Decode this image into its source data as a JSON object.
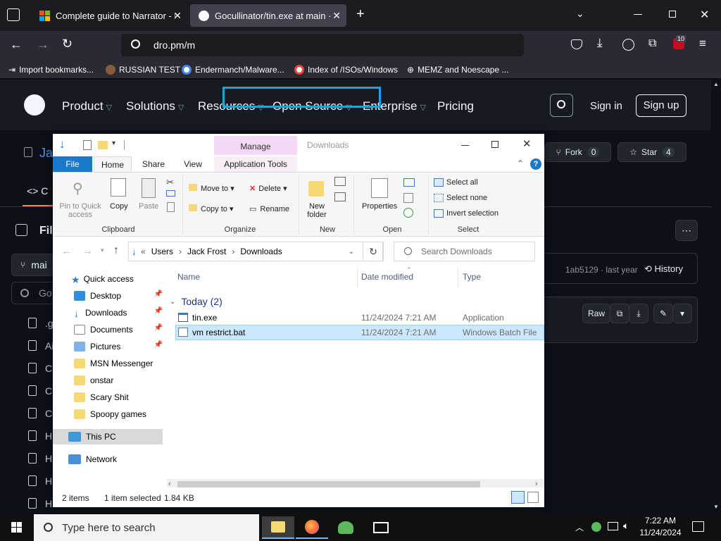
{
  "browser": {
    "tabs": [
      {
        "title": "Complete guide to Narrator - M",
        "active": false
      },
      {
        "title": "Gocullinator/tin.exe at main · Ja",
        "active": true
      }
    ],
    "url": "dro.pm/m",
    "extension_badge": "10",
    "bookmarks": [
      "Import bookmarks...",
      "RUSSIAN TEST",
      "Endermanch/Malware...",
      "Index of /ISOs/Windows",
      "MEMZ and Noescape ..."
    ]
  },
  "github": {
    "nav": [
      "Product",
      "Solutions",
      "Resources",
      "Open Source",
      "Enterprise",
      "Pricing"
    ],
    "sign_in": "Sign in",
    "sign_up": "Sign up",
    "repo_partial": "Ja",
    "fork_label": "Fork",
    "fork_count": "0",
    "star_label": "Star",
    "star_count": "4",
    "code_tab_partial": "C",
    "file_title_partial": "File",
    "branch_partial": "mai",
    "goto_partial": "Go",
    "commit": "1ab5129 · last year",
    "history": "History",
    "raw": "Raw",
    "tree_items": [
      ".g",
      "Ai",
      "Cl",
      "Cl",
      "Co",
      "H",
      "H",
      "H",
      "H"
    ]
  },
  "explorer": {
    "title": "Downloads",
    "manage": "Manage",
    "ribbon_tabs": [
      "File",
      "Home",
      "Share",
      "View",
      "Application Tools"
    ],
    "clipboard": {
      "pin": "Pin to Quick",
      "pin2": "access",
      "copy": "Copy",
      "paste": "Paste",
      "group": "Clipboard"
    },
    "organize": {
      "move_to": "Move to",
      "copy_to": "Copy to",
      "delete": "Delete",
      "rename": "Rename",
      "group": "Organize"
    },
    "new": {
      "new_folder": "New",
      "new_folder2": "folder",
      "group": "New"
    },
    "open": {
      "properties": "Properties",
      "group": "Open"
    },
    "select": {
      "select_all": "Select all",
      "select_none": "Select none",
      "invert": "Invert selection",
      "group": "Select"
    },
    "breadcrumb": [
      "Users",
      "Jack Frost",
      "Downloads"
    ],
    "search_placeholder": "Search Downloads",
    "nav": {
      "quick_access": "Quick access",
      "items": [
        "Desktop",
        "Downloads",
        "Documents",
        "Pictures",
        "MSN Messenger",
        "onstar",
        "Scary Shit",
        "Spoopy games"
      ],
      "this_pc": "This PC",
      "network": "Network"
    },
    "columns": [
      "Name",
      "Date modified",
      "Type"
    ],
    "group_header": "Today (2)",
    "files": [
      {
        "name": "tin.exe",
        "date": "11/24/2024 7:21 AM",
        "type": "Application"
      },
      {
        "name": "vm restrict.bat",
        "date": "11/24/2024 7:21 AM",
        "type": "Windows Batch File"
      }
    ],
    "status": {
      "items": "2 items",
      "selected": "1 item selected",
      "size": "1.84 KB"
    }
  },
  "taskbar": {
    "search_placeholder": "Type here to search",
    "time": "7:22 AM",
    "date": "11/24/2024"
  },
  "colors": {
    "highlight_box": "#1ea1e0",
    "selection": "#cce8ff",
    "manage_tab": "#f3d9f5",
    "file_tab": "#1979ca"
  }
}
